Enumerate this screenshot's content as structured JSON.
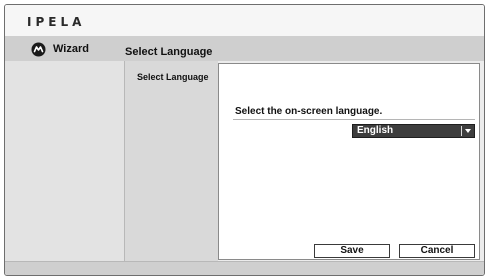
{
  "header": {
    "logo_text": "IPELA"
  },
  "nav": {
    "wizard_label": "Wizard",
    "wizard_icon": "wizard-icon",
    "page_title": "Select Language"
  },
  "steps": {
    "current": "Select Language"
  },
  "content": {
    "prompt": "Select the on-screen language.",
    "language_select": {
      "selected": "English",
      "icon": "chevron-down-icon"
    }
  },
  "buttons": {
    "save_label": "Save",
    "cancel_label": "Cancel"
  },
  "colors": {
    "frame_border": "#6e6e6e",
    "nav_bar": "#cfcfcf",
    "select_bg": "#3d3d3d"
  }
}
